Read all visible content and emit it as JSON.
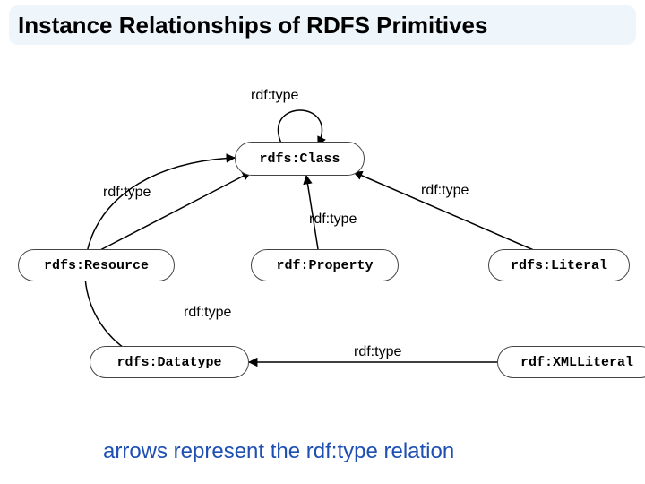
{
  "title": "Instance Relationships of RDFS Primitives",
  "caption": "arrows represent the rdf:type relation",
  "nodes": {
    "class": {
      "label": "rdfs:Class"
    },
    "resource": {
      "label": "rdfs:Resource"
    },
    "property": {
      "label": "rdf:Property"
    },
    "literal": {
      "label": "rdfs:Literal"
    },
    "datatype": {
      "label": "rdfs:Datatype"
    },
    "xmlliteral": {
      "label": "rdf:XMLLiteral"
    }
  },
  "edges": {
    "class_self": {
      "label": "rdf:type"
    },
    "resource_up": {
      "label": "rdf:type"
    },
    "property_up": {
      "label": "rdf:type"
    },
    "literal_up": {
      "label": "rdf:type"
    },
    "datatype_up": {
      "label": "rdf:type"
    },
    "xml_to_dt": {
      "label": "rdf:type"
    }
  },
  "chart_data": {
    "type": "diagram",
    "title": "Instance Relationships of RDFS Primitives",
    "relation_label": "rdf:type",
    "nodes": [
      "rdfs:Class",
      "rdfs:Resource",
      "rdf:Property",
      "rdfs:Literal",
      "rdfs:Datatype",
      "rdf:XMLLiteral"
    ],
    "edges": [
      {
        "from": "rdfs:Class",
        "to": "rdfs:Class",
        "label": "rdf:type"
      },
      {
        "from": "rdfs:Resource",
        "to": "rdfs:Class",
        "label": "rdf:type"
      },
      {
        "from": "rdf:Property",
        "to": "rdfs:Class",
        "label": "rdf:type"
      },
      {
        "from": "rdfs:Literal",
        "to": "rdfs:Class",
        "label": "rdf:type"
      },
      {
        "from": "rdfs:Datatype",
        "to": "rdfs:Class",
        "label": "rdf:type"
      },
      {
        "from": "rdf:XMLLiteral",
        "to": "rdfs:Datatype",
        "label": "rdf:type"
      }
    ],
    "caption": "arrows represent the rdf:type relation"
  }
}
